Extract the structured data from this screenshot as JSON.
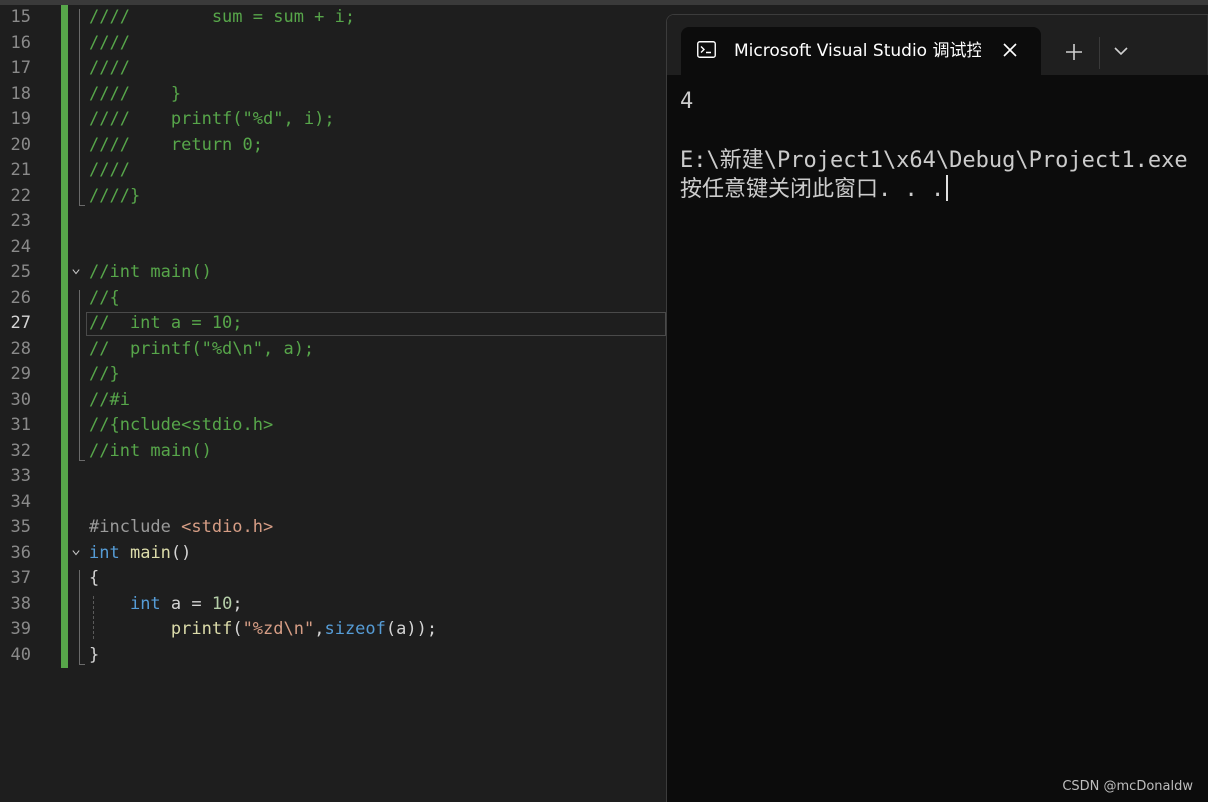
{
  "editor": {
    "current_line": "27",
    "lines": [
      {
        "num": "15",
        "code": [
          {
            "t": "cmt",
            "s": "////        sum = sum + i;"
          }
        ]
      },
      {
        "num": "16",
        "code": [
          {
            "t": "cmt",
            "s": "////"
          }
        ]
      },
      {
        "num": "17",
        "code": [
          {
            "t": "cmt",
            "s": "////"
          }
        ]
      },
      {
        "num": "18",
        "code": [
          {
            "t": "cmt",
            "s": "////    }"
          }
        ]
      },
      {
        "num": "19",
        "code": [
          {
            "t": "cmt",
            "s": "////    printf(\"%d\", i);"
          }
        ]
      },
      {
        "num": "20",
        "code": [
          {
            "t": "cmt",
            "s": "////    return 0;"
          }
        ]
      },
      {
        "num": "21",
        "code": [
          {
            "t": "cmt",
            "s": "////"
          }
        ]
      },
      {
        "num": "22",
        "code": [
          {
            "t": "cmt",
            "s": "////}"
          }
        ]
      },
      {
        "num": "23",
        "code": []
      },
      {
        "num": "24",
        "code": []
      },
      {
        "num": "25",
        "code": [
          {
            "t": "cmt",
            "s": "//int main()"
          }
        ]
      },
      {
        "num": "26",
        "code": [
          {
            "t": "cmt",
            "s": "//{"
          }
        ]
      },
      {
        "num": "27",
        "code": [
          {
            "t": "cmt",
            "s": "//  int a = 10;"
          }
        ]
      },
      {
        "num": "28",
        "code": [
          {
            "t": "cmt",
            "s": "//  printf(\"%d\\n\", a);"
          }
        ]
      },
      {
        "num": "29",
        "code": [
          {
            "t": "cmt",
            "s": "//}"
          }
        ]
      },
      {
        "num": "30",
        "code": [
          {
            "t": "cmt",
            "s": "//#i"
          }
        ]
      },
      {
        "num": "31",
        "code": [
          {
            "t": "cmt",
            "s": "//{nclude<stdio.h>"
          }
        ]
      },
      {
        "num": "32",
        "code": [
          {
            "t": "cmt",
            "s": "//int main()"
          }
        ]
      },
      {
        "num": "33",
        "code": []
      },
      {
        "num": "34",
        "code": []
      },
      {
        "num": "35",
        "code": [
          {
            "t": "pp",
            "s": "#include "
          },
          {
            "t": "hdr",
            "s": "<stdio.h>"
          }
        ]
      },
      {
        "num": "36",
        "code": [
          {
            "t": "kw",
            "s": "int"
          },
          {
            "t": "txt",
            "s": " "
          },
          {
            "t": "fn",
            "s": "main"
          },
          {
            "t": "txt",
            "s": "()"
          }
        ]
      },
      {
        "num": "37",
        "code": [
          {
            "t": "txt",
            "s": "{"
          }
        ]
      },
      {
        "num": "38",
        "code": [
          {
            "t": "txt",
            "s": "    "
          },
          {
            "t": "kw",
            "s": "int"
          },
          {
            "t": "txt",
            "s": " a = "
          },
          {
            "t": "num",
            "s": "10"
          },
          {
            "t": "txt",
            "s": ";"
          }
        ]
      },
      {
        "num": "39",
        "code": [
          {
            "t": "txt",
            "s": "        "
          },
          {
            "t": "fn",
            "s": "printf"
          },
          {
            "t": "txt",
            "s": "("
          },
          {
            "t": "str",
            "s": "\"%zd\\n\""
          },
          {
            "t": "txt",
            "s": ","
          },
          {
            "t": "kw",
            "s": "sizeof"
          },
          {
            "t": "txt",
            "s": "(a));"
          }
        ]
      },
      {
        "num": "40",
        "code": [
          {
            "t": "txt",
            "s": "}"
          }
        ]
      }
    ],
    "fold_lines": [
      "25",
      "36"
    ]
  },
  "console": {
    "tab_title": "Microsoft Visual Studio 调试控制台",
    "tab_icon": "console-icon",
    "close_icon": "close-icon",
    "new_tab_icon": "plus-icon",
    "dropdown_icon": "chevron-down-icon",
    "output_lines": [
      "4",
      "",
      "E:\\新建\\Project1\\x64\\Debug\\Project1.exe",
      "按任意键关闭此窗口. . ."
    ]
  },
  "watermark": "CSDN @mcDonaldw",
  "colors": {
    "editor_bg": "#1e1e1e",
    "comment": "#57a64a",
    "keyword": "#569cd6",
    "function": "#dcdcaa",
    "string": "#d69d85",
    "console_bg": "#0c0c0c"
  }
}
